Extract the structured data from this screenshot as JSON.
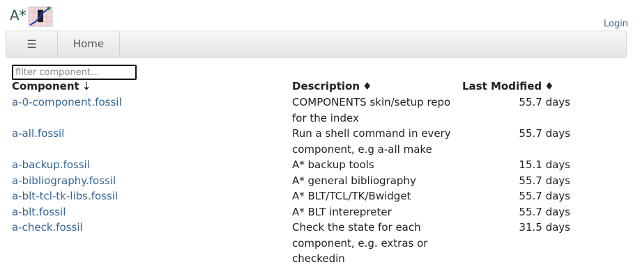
{
  "header": {
    "logo_text": "A*",
    "login_label": "Login"
  },
  "navbar": {
    "menu_icon": "☰",
    "home_label": "Home"
  },
  "filter": {
    "placeholder": "filter component..."
  },
  "table": {
    "headers": {
      "component": "Component",
      "component_sort": "⇣",
      "description": "Description",
      "description_sort": "♦",
      "last_modified": "Last Modified",
      "last_modified_sort": "♦"
    },
    "rows": [
      {
        "name": "a-0-component.fossil",
        "description": "COMPONENTS skin/setup repo for the index",
        "modified": "55.7 days"
      },
      {
        "name": "a-all.fossil",
        "description": "Run a shell command in every component, e.g a-all make",
        "modified": "55.7 days"
      },
      {
        "name": "a-backup.fossil",
        "description": "A* backup tools",
        "modified": "15.1 days"
      },
      {
        "name": "a-bibliography.fossil",
        "description": "A* general bibliography",
        "modified": "55.7 days"
      },
      {
        "name": "a-blt-tcl-tk-libs.fossil",
        "description": "A* BLT/TCL/TK/Bwidget",
        "modified": "55.7 days"
      },
      {
        "name": "a-blt.fossil",
        "description": "A* BLT interepreter",
        "modified": "55.7 days"
      },
      {
        "name": "a-check.fossil",
        "description": "Check the state for each component, e.g. extras or checkedin",
        "modified": "31.5 days"
      }
    ]
  }
}
